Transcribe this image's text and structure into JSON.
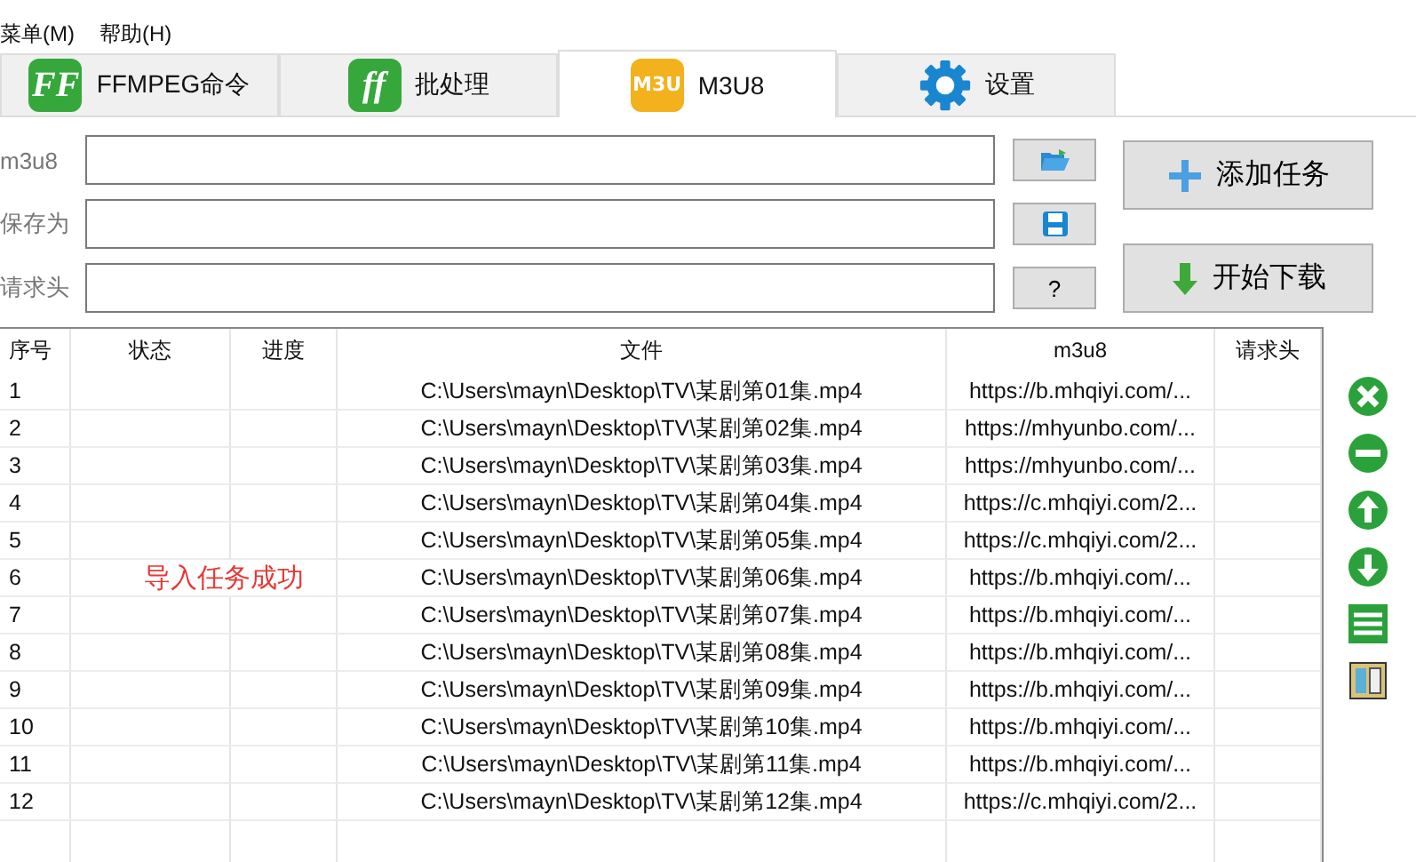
{
  "menu": [
    {
      "label": "菜单(M)"
    },
    {
      "label": "帮助(H)"
    }
  ],
  "tabs": [
    {
      "label": "FFMPEG命令",
      "kind": "ff",
      "icon_text": "FF",
      "selected": false
    },
    {
      "label": "批处理",
      "kind": "batch",
      "icon_text": "ff",
      "selected": false
    },
    {
      "label": "M3U8",
      "kind": "m3u",
      "icon_text": "M3U",
      "selected": true
    },
    {
      "label": "设置",
      "kind": "gear",
      "selected": false
    }
  ],
  "fields": [
    {
      "label": "m3u8",
      "kind": "folder"
    },
    {
      "label": "保存为",
      "kind": "save"
    },
    {
      "label": "请求头",
      "kind": "help",
      "button_text": "?"
    }
  ],
  "actions": [
    {
      "label": "添加任务",
      "kind": "add"
    },
    {
      "label": "开始下载",
      "kind": "download"
    }
  ],
  "table": {
    "columns": [
      "序号",
      "状态",
      "进度",
      "文件",
      "m3u8",
      "请求头"
    ],
    "rows": [
      {
        "num": "1",
        "file": "C:\\Users\\mayn\\Desktop\\TV\\某剧第01集.mp4",
        "m3u8": "https://b.mhqiyi.com/..."
      },
      {
        "num": "2",
        "file": "C:\\Users\\mayn\\Desktop\\TV\\某剧第02集.mp4",
        "m3u8": "https://mhyunbo.com/..."
      },
      {
        "num": "3",
        "file": "C:\\Users\\mayn\\Desktop\\TV\\某剧第03集.mp4",
        "m3u8": "https://mhyunbo.com/..."
      },
      {
        "num": "4",
        "file": "C:\\Users\\mayn\\Desktop\\TV\\某剧第04集.mp4",
        "m3u8": "https://c.mhqiyi.com/2..."
      },
      {
        "num": "5",
        "file": "C:\\Users\\mayn\\Desktop\\TV\\某剧第05集.mp4",
        "m3u8": "https://c.mhqiyi.com/2..."
      },
      {
        "num": "6",
        "file": "C:\\Users\\mayn\\Desktop\\TV\\某剧第06集.mp4",
        "m3u8": "https://b.mhqiyi.com/..."
      },
      {
        "num": "7",
        "file": "C:\\Users\\mayn\\Desktop\\TV\\某剧第07集.mp4",
        "m3u8": "https://b.mhqiyi.com/..."
      },
      {
        "num": "8",
        "file": "C:\\Users\\mayn\\Desktop\\TV\\某剧第08集.mp4",
        "m3u8": "https://b.mhqiyi.com/..."
      },
      {
        "num": "9",
        "file": "C:\\Users\\mayn\\Desktop\\TV\\某剧第09集.mp4",
        "m3u8": "https://b.mhqiyi.com/..."
      },
      {
        "num": "10",
        "file": "C:\\Users\\mayn\\Desktop\\TV\\某剧第10集.mp4",
        "m3u8": "https://b.mhqiyi.com/..."
      },
      {
        "num": "11",
        "file": "C:\\Users\\mayn\\Desktop\\TV\\某剧第11集.mp4",
        "m3u8": "https://b.mhqiyi.com/..."
      },
      {
        "num": "12",
        "file": "C:\\Users\\mayn\\Desktop\\TV\\某剧第12集.mp4",
        "m3u8": "https://c.mhqiyi.com/2..."
      }
    ]
  },
  "toast": "导入任务成功",
  "side_tools": [
    {
      "kind": "clear"
    },
    {
      "kind": "remove"
    },
    {
      "kind": "up"
    },
    {
      "kind": "down"
    },
    {
      "kind": "list"
    },
    {
      "kind": "book"
    }
  ]
}
